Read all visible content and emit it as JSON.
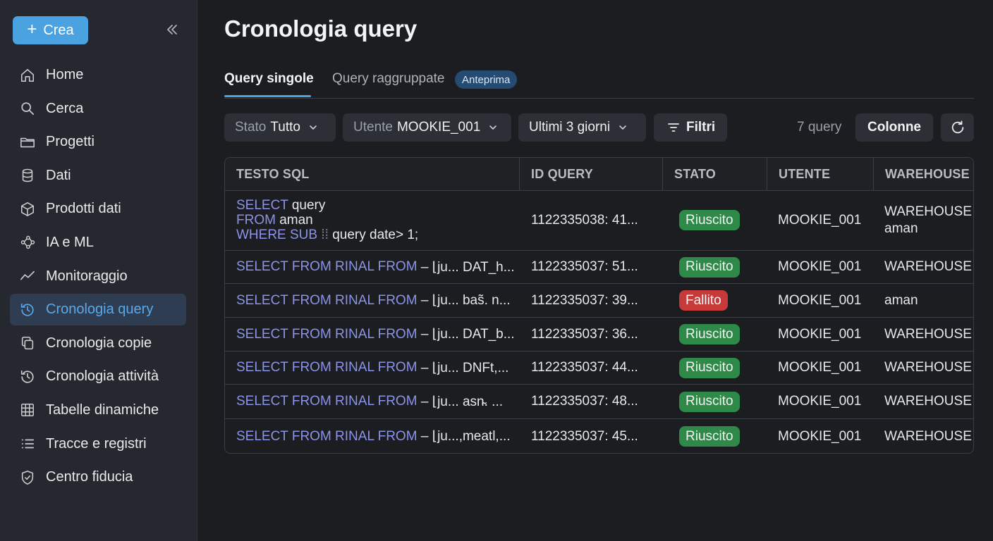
{
  "sidebar": {
    "create_label": "Crea",
    "items": [
      {
        "label": "Home",
        "icon": "home-icon"
      },
      {
        "label": "Cerca",
        "icon": "search-icon"
      },
      {
        "label": "Progetti",
        "icon": "folder-icon"
      },
      {
        "label": "Dati",
        "icon": "database-icon"
      },
      {
        "label": "Prodotti dati",
        "icon": "cube-icon"
      },
      {
        "label": "IA e ML",
        "icon": "ai-network-icon"
      },
      {
        "label": "Monitoraggio",
        "icon": "activity-chart-icon"
      },
      {
        "label": "Cronologia query",
        "icon": "history-icon",
        "active": true
      },
      {
        "label": "Cronologia copie",
        "icon": "copy-icon"
      },
      {
        "label": "Cronologia attività",
        "icon": "history-icon"
      },
      {
        "label": "Tabelle dinamiche",
        "icon": "table-grid-icon"
      },
      {
        "label": "Tracce e registri",
        "icon": "list-icon"
      },
      {
        "label": "Centro fiducia",
        "icon": "shield-check-icon"
      }
    ]
  },
  "page": {
    "title": "Cronologia query",
    "tabs": [
      {
        "label": "Query singole",
        "active": true
      },
      {
        "label": "Query raggruppate",
        "badge": "Anteprima"
      }
    ]
  },
  "toolbar": {
    "status_filter": {
      "key": "Stato",
      "value": "Tutto"
    },
    "user_filter": {
      "key": "Utente",
      "value": "MOOKIE_001"
    },
    "time_filter": {
      "value": "Ultimi 3 giorni"
    },
    "filters_label": "Filtri",
    "count_label": "7 query",
    "columns_label": "Colonne"
  },
  "table": {
    "headers": [
      "TESTO SQL",
      "ID QUERY",
      "STATO",
      "UTENTE",
      "WAREHOUSE"
    ],
    "first_row": {
      "sql_lines": [
        {
          "kw": "SELECT",
          "rest": "query"
        },
        {
          "kw": "FROM",
          "rest": "aman"
        },
        {
          "kw": "WHERE SUB",
          "rest": "query date> 1;"
        }
      ],
      "query_id": "1122335038: 41...",
      "status": "Riuscito",
      "status_kind": "success",
      "user": "MOOKIE_001",
      "warehouse_lines": [
        "WAREHOUSE",
        "aman"
      ]
    },
    "rows": [
      {
        "sql_kw": "SELECT FROM RINAL FROM",
        "sql_rest": "– ⌊ju... DAT_h...",
        "query_id": "1122335037: 51...",
        "status": "Riuscito",
        "status_kind": "success",
        "user": "MOOKIE_001",
        "warehouse": "WAREHOUSE"
      },
      {
        "sql_kw": "SELECT FROM RINAL FROM",
        "sql_rest": "– ⌊ju... bas̃. n...",
        "query_id": "1122335037: 39...",
        "status": "Fallito",
        "status_kind": "failed",
        "user": "MOOKIE_001",
        "warehouse": "aman"
      },
      {
        "sql_kw": "SELECT FROM RINAL FROM",
        "sql_rest": "– ⌊ju... DAT_b...",
        "query_id": "1122335037: 36...",
        "status": "Riuscito",
        "status_kind": "success",
        "user": "MOOKIE_001",
        "warehouse": "WAREHOUSE"
      },
      {
        "sql_kw": "SELECT FROM RINAL FROM",
        "sql_rest": "– ⌊ju... DNFt,...",
        "query_id": "1122335037: 44...",
        "status": "Riuscito",
        "status_kind": "success",
        "user": "MOOKIE_001",
        "warehouse": "WAREHOUSE"
      },
      {
        "sql_kw": "SELECT FROM RINAL FROM",
        "sql_rest": "– ⌊ju... asn̴. ...",
        "query_id": "1122335037: 48...",
        "status": "Riuscito",
        "status_kind": "success",
        "user": "MOOKIE_001",
        "warehouse": "WAREHOUSE"
      },
      {
        "sql_kw": "SELECT FROM RINAL FROM",
        "sql_rest": "– ⌊ju...,meatl,...",
        "query_id": "1122335037: 45...",
        "status": "Riuscito",
        "status_kind": "success",
        "user": "MOOKIE_001",
        "warehouse": "WAREHOUSE"
      }
    ]
  },
  "colors": {
    "accent": "#4aa3e0",
    "success": "#2f8a4a",
    "failed": "#c83a3a",
    "sql_keyword": "#8b94e8"
  }
}
